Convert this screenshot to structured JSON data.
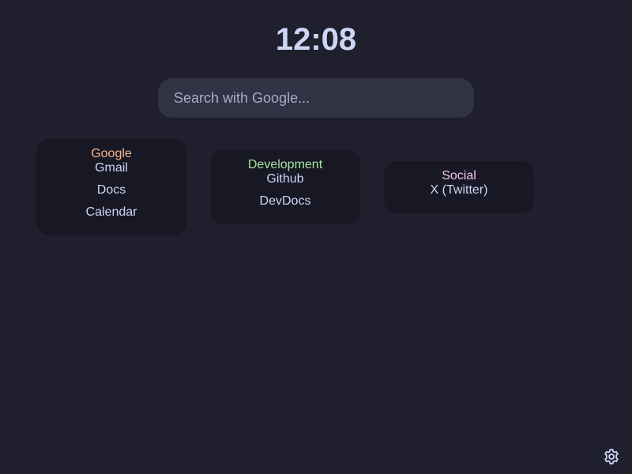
{
  "clock": {
    "time": "12:08"
  },
  "search": {
    "placeholder": "Search with Google..."
  },
  "groups": [
    {
      "title": "Google",
      "title_color": "#fab387",
      "links": [
        "Gmail",
        "Docs",
        "Calendar"
      ]
    },
    {
      "title": "Development",
      "title_color": "#a6e3a1",
      "links": [
        "Github",
        "DevDocs"
      ]
    },
    {
      "title": "Social",
      "title_color": "#f5c2e7",
      "links": [
        "X (Twitter)"
      ]
    }
  ],
  "settings": {
    "icon": "gear-icon"
  },
  "colors": {
    "background": "#1f1f2e",
    "card": "#181825",
    "search_bg": "#313244",
    "text": "#cdd6f4"
  }
}
